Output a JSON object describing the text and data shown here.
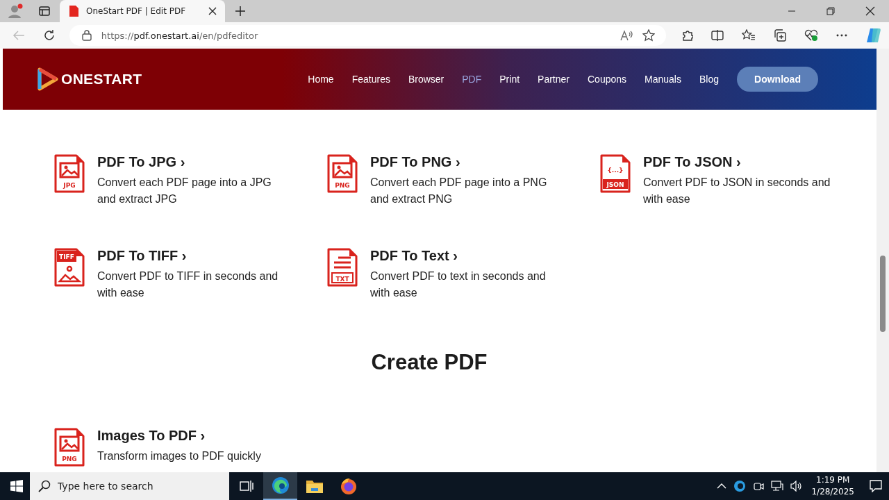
{
  "browser": {
    "tab_title": "OneStart PDF | Edit PDF",
    "url_scheme": "https://",
    "url_host": "pdf.onestart.ai",
    "url_path": "/en/pdfeditor"
  },
  "site_header": {
    "logo": "ONESTART",
    "nav": [
      {
        "label": "Home",
        "selected": false
      },
      {
        "label": "Features",
        "selected": false
      },
      {
        "label": "Browser",
        "selected": false
      },
      {
        "label": "PDF",
        "selected": true
      },
      {
        "label": "Print",
        "selected": false
      },
      {
        "label": "Partner",
        "selected": false
      },
      {
        "label": "Coupons",
        "selected": false
      },
      {
        "label": "Manuals",
        "selected": false
      },
      {
        "label": "Blog",
        "selected": false
      }
    ],
    "button": "Download"
  },
  "convert_tools": [
    {
      "title": "PDF To JPG ›",
      "description": "Convert each PDF page into a JPG and extract JPG",
      "kind": "image",
      "icon_label": "JPG"
    },
    {
      "title": "PDF To PNG ›",
      "description": "Convert each PDF page into a PNG and extract PNG",
      "kind": "image",
      "icon_label": "PNG"
    },
    {
      "title": "PDF To JSON ›",
      "description": "Convert PDF to JSON in seconds and with ease",
      "kind": "json",
      "icon_label": "JSON",
      "icon_symbol": "{...}"
    },
    {
      "title": "PDF To TIFF ›",
      "description": "Convert PDF to TIFF in seconds and with ease",
      "kind": "tiff",
      "icon_label": "TIFF"
    },
    {
      "title": "PDF To Text ›",
      "description": "Convert PDF to text in seconds and with ease",
      "kind": "text",
      "icon_label": "TXT"
    }
  ],
  "create_section": {
    "heading": "Create PDF",
    "tools": [
      {
        "title": "Images To PDF ›",
        "description": "Transform images to PDF quickly",
        "kind": "image",
        "icon_label": "PNG"
      }
    ]
  },
  "taskbar": {
    "search_placeholder": "Type here to search",
    "apps": [
      {
        "kind": "taskview",
        "selected": false
      },
      {
        "kind": "edge",
        "selected": true
      },
      {
        "kind": "folder",
        "selected": false
      },
      {
        "kind": "firefox",
        "selected": false
      }
    ],
    "time": "1:19 PM",
    "date": "1/28/2025"
  }
}
